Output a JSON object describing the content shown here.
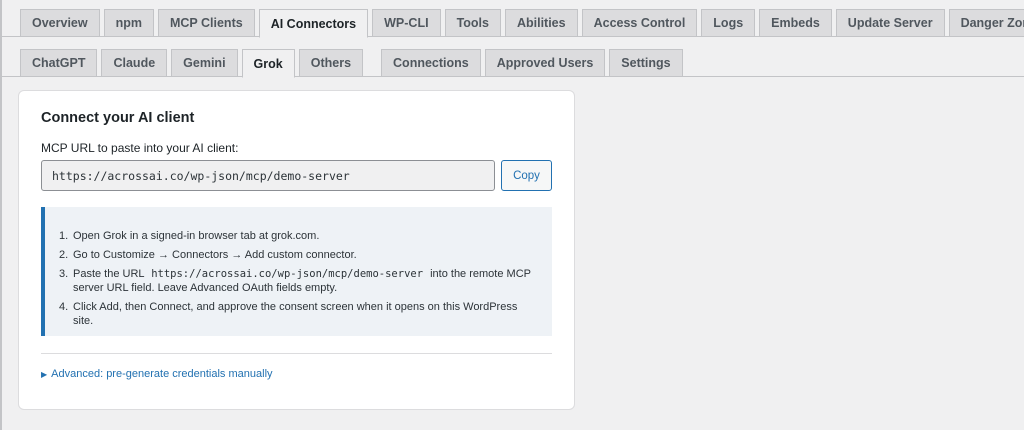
{
  "primary_tabs": [
    "Overview",
    "npm",
    "MCP Clients",
    "AI Connectors",
    "WP-CLI",
    "Tools",
    "Abilities",
    "Access Control",
    "Logs",
    "Embeds",
    "Update Server",
    "Danger Zone"
  ],
  "active_primary_tab": "AI Connectors",
  "secondary_tabs": [
    "ChatGPT",
    "Claude",
    "Gemini",
    "Grok",
    "Others",
    "Connections",
    "Approved Users",
    "Settings"
  ],
  "active_secondary_tab": "Grok",
  "card": {
    "title": "Connect your AI client",
    "url_label": "MCP URL to paste into your AI client:",
    "url_value": "https://acrossai.co/wp-json/mcp/demo-server",
    "copy_label": "Copy",
    "steps": [
      {
        "num": "1.",
        "text": "Open Grok in a signed-in browser tab at grok.com."
      },
      {
        "num": "2.",
        "text": "Go to Customize → Connectors → Add custom connector."
      },
      {
        "num": "3.",
        "pre": "Paste the URL",
        "code": "https://acrossai.co/wp-json/mcp/demo-server",
        "post": "into the remote MCP server URL field. Leave Advanced OAuth fields empty."
      },
      {
        "num": "4.",
        "text": "Click Add, then Connect, and approve the consent screen when it opens on this WordPress site."
      }
    ],
    "advanced_label": "Advanced: pre-generate credentials manually"
  },
  "colors": {
    "accent": "#2271b1",
    "page_bg": "#f0f0f1",
    "tab_bg": "#dcdcde",
    "notice_bg": "#eef2f6"
  },
  "icons": {
    "advanced_toggle": "triangle-right-icon"
  }
}
